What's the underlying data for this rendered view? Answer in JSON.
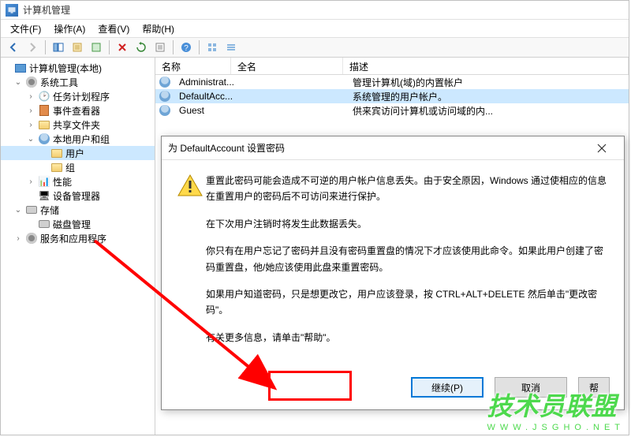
{
  "window": {
    "title": "计算机管理"
  },
  "menu": {
    "file": "文件(F)",
    "action": "操作(A)",
    "view": "查看(V)",
    "help": "帮助(H)"
  },
  "tree": {
    "root": "计算机管理(本地)",
    "system_tools": "系统工具",
    "task_scheduler": "任务计划程序",
    "event_viewer": "事件查看器",
    "shared_folders": "共享文件夹",
    "local_users": "本地用户和组",
    "users": "用户",
    "groups": "组",
    "performance": "性能",
    "device_manager": "设备管理器",
    "storage": "存储",
    "disk_management": "磁盘管理",
    "services_apps": "服务和应用程序"
  },
  "list": {
    "col_name": "名称",
    "col_fullname": "全名",
    "col_desc": "描述",
    "rows": [
      {
        "name": "Administrat...",
        "fullname": "",
        "desc": "管理计算机(域)的内置帐户"
      },
      {
        "name": "DefaultAcc...",
        "fullname": "",
        "desc": "系统管理的用户帐户。"
      },
      {
        "name": "Guest",
        "fullname": "",
        "desc": "供来宾访问计算机或访问域的内..."
      }
    ]
  },
  "dialog": {
    "title": "为 DefaultAccount 设置密码",
    "para1": "重置此密码可能会造成不可逆的用户帐户信息丢失。由于安全原因，Windows 通过使相应的信息在重置用户的密码后不可访问来进行保护。",
    "para2": "在下次用户注销时将发生此数据丢失。",
    "para3": "你只有在用户忘记了密码并且没有密码重置盘的情况下才应该使用此命令。如果此用户创建了密码重置盘，他/她应该使用此盘来重置密码。",
    "para4": "如果用户知道密码，只是想更改它，用户应该登录，按 CTRL+ALT+DELETE 然后单击\"更改密码\"。",
    "para5": "有关更多信息，请单击\"帮助\"。",
    "btn_continue": "继续(P)",
    "btn_cancel": "取消",
    "btn_help": "帮"
  },
  "watermark": {
    "main": "技术员联盟",
    "sub": "WWW.JSGHO.NET"
  }
}
